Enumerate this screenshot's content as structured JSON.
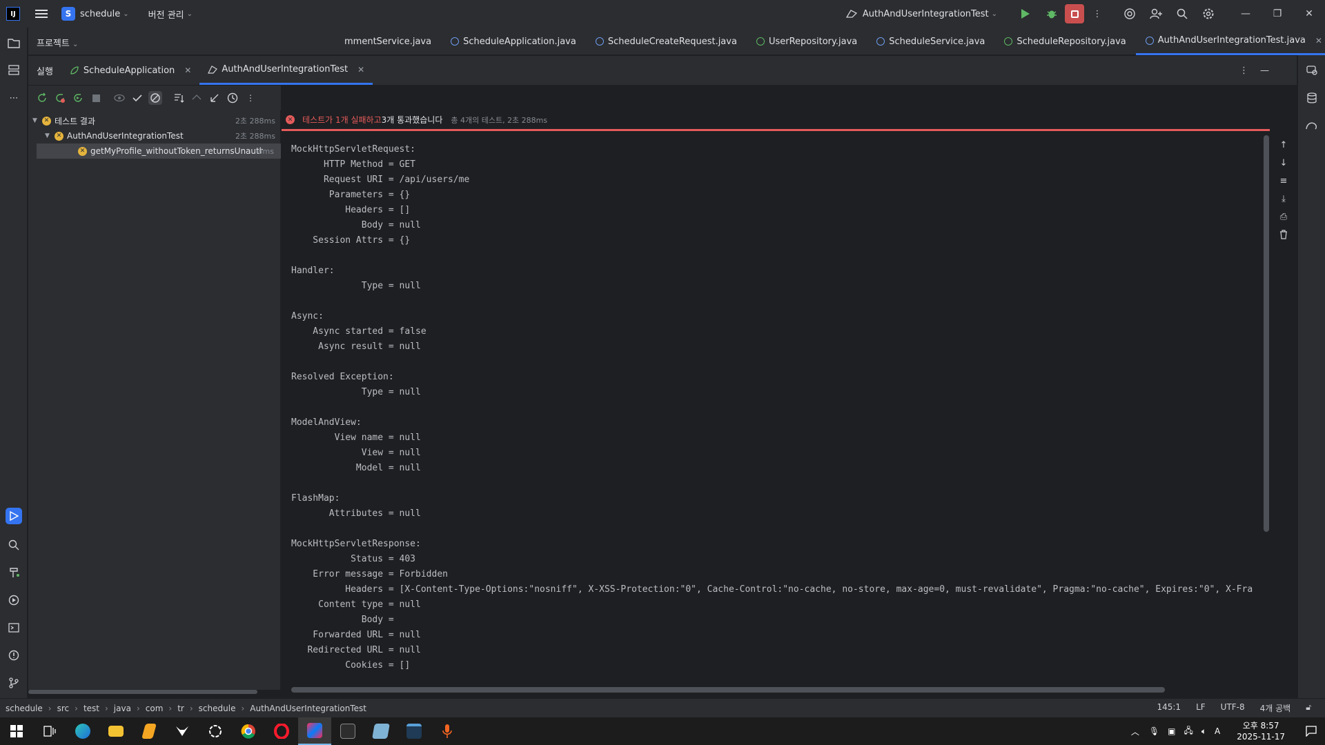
{
  "titlebar": {
    "project_badge": "S",
    "project_name": "schedule",
    "vcs_label": "버전 관리",
    "run_config": "AuthAndUserIntegrationTest"
  },
  "project_row": {
    "label": "프로젝트",
    "tabs": [
      {
        "label": "mmentService.java",
        "icon": "class-icon"
      },
      {
        "label": "ScheduleApplication.java",
        "icon": "spring-class-icon"
      },
      {
        "label": "ScheduleCreateRequest.java",
        "icon": "class-icon"
      },
      {
        "label": "UserRepository.java",
        "icon": "interface-icon"
      },
      {
        "label": "ScheduleService.java",
        "icon": "class-icon"
      },
      {
        "label": "ScheduleRepository.java",
        "icon": "interface-icon"
      },
      {
        "label": "AuthAndUserIntegrationTest.java",
        "icon": "test-class-icon"
      }
    ]
  },
  "run_tabs": {
    "run_label": "실행",
    "tab1": "ScheduleApplication",
    "tab2": "AuthAndUserIntegrationTest"
  },
  "tree": {
    "root_label": "테스트 결과",
    "root_time": "2초 288ms",
    "class_label": "AuthAndUserIntegrationTest",
    "class_time": "2초 288ms",
    "method_label": "getMyProfile_withoutToken_returnsUnauthor",
    "method_time": "8ms"
  },
  "status": {
    "fail_text": "테스트가 1개 실패하고",
    "pass_text": " 3개 통과했습니다",
    "meta": "총 4개의 테스트, 2초 288ms"
  },
  "console_lines": [
    "MockHttpServletRequest:",
    "      HTTP Method = GET",
    "      Request URI = /api/users/me",
    "       Parameters = {}",
    "          Headers = []",
    "             Body = null",
    "    Session Attrs = {}",
    "",
    "Handler:",
    "             Type = null",
    "",
    "Async:",
    "    Async started = false",
    "     Async result = null",
    "",
    "Resolved Exception:",
    "             Type = null",
    "",
    "ModelAndView:",
    "        View name = null",
    "             View = null",
    "            Model = null",
    "",
    "FlashMap:",
    "       Attributes = null",
    "",
    "MockHttpServletResponse:",
    "           Status = 403",
    "    Error message = Forbidden",
    "          Headers = [X-Content-Type-Options:\"nosniff\", X-XSS-Protection:\"0\", Cache-Control:\"no-cache, no-store, max-age=0, must-revalidate\", Pragma:\"no-cache\", Expires:\"0\", X-Fra",
    "     Content type = null",
    "             Body = ",
    "    Forwarded URL = null",
    "   Redirected URL = null",
    "          Cookies = []"
  ],
  "breadcrumb": [
    "schedule",
    "src",
    "test",
    "java",
    "com",
    "tr",
    "schedule",
    "AuthAndUserIntegrationTest"
  ],
  "statusbar": {
    "position": "145:1",
    "line_sep": "LF",
    "encoding": "UTF-8",
    "indent": "4개 공백"
  },
  "taskbar": {
    "time": "오후 8:57",
    "date": "2025-11-17",
    "ime": "A"
  },
  "colors": {
    "accent": "#3574f0",
    "fail": "#e55b5b",
    "warn": "#e5b43d"
  }
}
